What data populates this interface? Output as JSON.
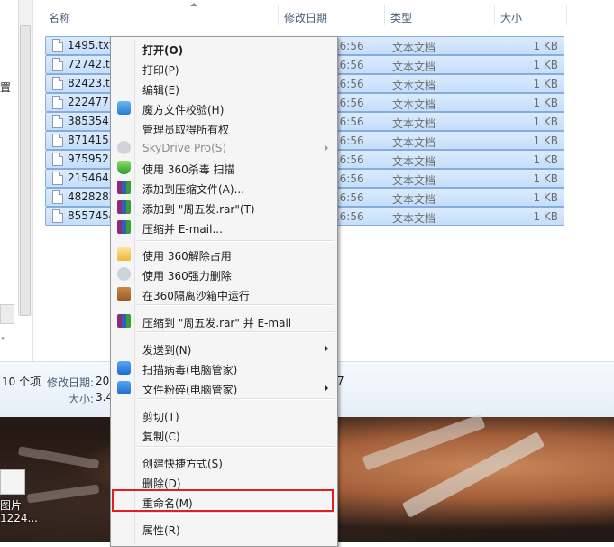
{
  "nav": {
    "label": "置",
    "tiny": "∘"
  },
  "columns": {
    "name": "名称",
    "date": "修改日期",
    "type": "类型",
    "size": "大小"
  },
  "files": [
    {
      "name": "1495.txt",
      "date": "16:56",
      "type": "文本文档",
      "size": "1 KB"
    },
    {
      "name": "72742.tx",
      "date": "16:56",
      "type": "文本文档",
      "size": "1 KB"
    },
    {
      "name": "82423.tx",
      "date": "16:56",
      "type": "文本文档",
      "size": "1 KB"
    },
    {
      "name": "222477.",
      "date": "16:56",
      "type": "文本文档",
      "size": "1 KB"
    },
    {
      "name": "385354.",
      "date": "16:56",
      "type": "文本文档",
      "size": "1 KB"
    },
    {
      "name": "871415.",
      "date": "16:56",
      "type": "文本文档",
      "size": "1 KB"
    },
    {
      "name": "975952.",
      "date": "16:56",
      "type": "文本文档",
      "size": "1 KB"
    },
    {
      "name": "2154645",
      "date": "16:56",
      "type": "文本文档",
      "size": "1 KB"
    },
    {
      "name": "4828282",
      "date": "16:56",
      "type": "文本文档",
      "size": "1 KB"
    },
    {
      "name": "8557454",
      "date": "16:56",
      "type": "文本文档",
      "size": "1 KB"
    }
  ],
  "details": {
    "count": "10 个项",
    "modified_label": "修改日期:",
    "modified_value": "20",
    "modified_tail": "7",
    "size_label": "大小:",
    "size_value": "3.4"
  },
  "desktop": {
    "icon_label_1": "图片",
    "icon_label_2": "1224..."
  },
  "menu": {
    "items": [
      {
        "label": "打开(O)",
        "bold": true
      },
      {
        "label": "打印(P)"
      },
      {
        "label": "编辑(E)"
      },
      {
        "label": "魔方文件校验(H)",
        "icon": "rubik-cube-icon"
      },
      {
        "label": "管理员取得所有权"
      },
      {
        "label": "SkyDrive Pro(S)",
        "icon": "cloud-icon",
        "disabled": true,
        "submenu": true
      },
      {
        "label": "使用 360杀毒 扫描",
        "icon": "360-antivirus-shield-icon"
      },
      {
        "label": "添加到压缩文件(A)...",
        "icon": "winrar-archive-icon"
      },
      {
        "label": "添加到 \"周五发.rar\"(T)",
        "icon": "winrar-archive-icon"
      },
      {
        "label": "压缩并 E-mail...",
        "icon": "winrar-archive-icon"
      },
      {
        "label": "使用 360解除占用",
        "icon": "unlock-folder-icon"
      },
      {
        "label": "使用 360强力删除",
        "icon": "shredder-icon"
      },
      {
        "label": "在360隔离沙箱中运行",
        "icon": "sandbox-box-icon"
      },
      {
        "label": "压缩到 \"周五发.rar\" 并 E-mail",
        "icon": "winrar-archive-icon"
      },
      {
        "label": "发送到(N)",
        "submenu": true
      },
      {
        "label": "扫描病毒(电脑管家)",
        "icon": "pc-manager-icon"
      },
      {
        "label": "文件粉碎(电脑管家)",
        "icon": "pc-manager-icon",
        "submenu": true
      },
      {
        "label": "剪切(T)"
      },
      {
        "label": "复制(C)"
      },
      {
        "label": "创建快捷方式(S)"
      },
      {
        "label": "删除(D)"
      },
      {
        "label": "重命名(M)"
      },
      {
        "label": "属性(R)"
      }
    ]
  },
  "colors": {
    "selection": "#c4defc",
    "highlight_box": "#e02020"
  }
}
